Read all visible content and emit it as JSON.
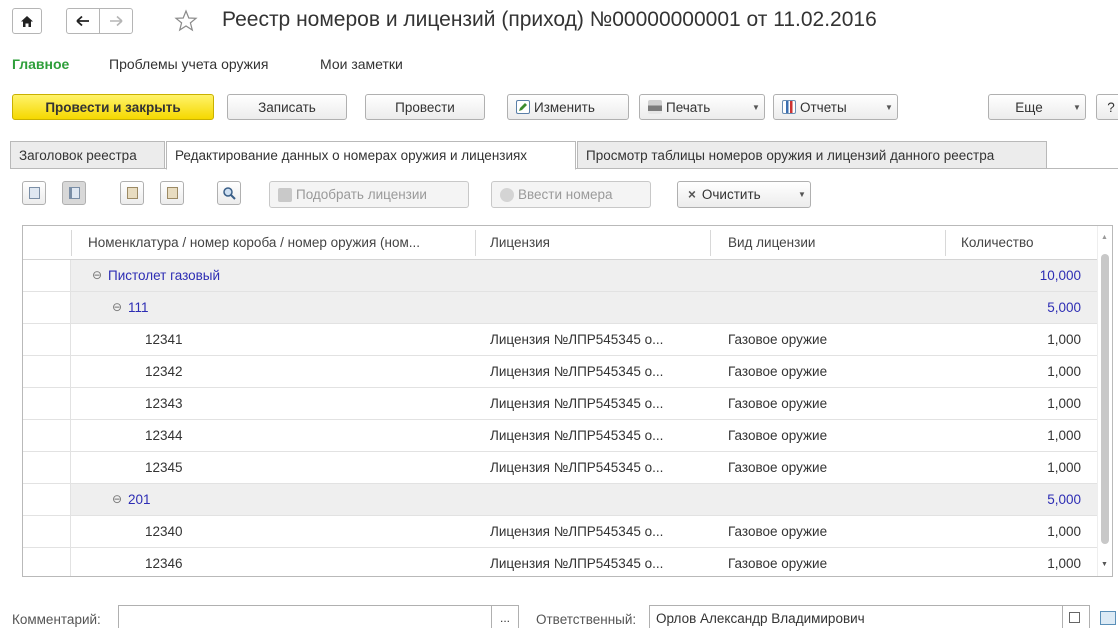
{
  "window": {
    "title": "Реестр номеров и лицензий (приход) №00000000001 от 11.02.2016",
    "icons": [
      "home-icon",
      "back-arrow-icon",
      "forward-arrow-icon",
      "star-icon"
    ]
  },
  "subnav": {
    "items": [
      "Главное",
      "Проблемы учета оружия",
      "Мои заметки"
    ]
  },
  "toolbar": {
    "post_close": "Провести и закрыть",
    "save": "Записать",
    "post": "Провести",
    "edit": "Изменить",
    "print": "Печать",
    "reports": "Отчеты",
    "more": "Еще",
    "help": "?"
  },
  "tabs": [
    {
      "label": "Заголовок реестра"
    },
    {
      "label": "Редактирование данных о номерах оружия и лицензиях"
    },
    {
      "label": "Просмотр таблицы номеров оружия и лицензий данного реестра"
    }
  ],
  "table_toolbar": {
    "pick_licenses": "Подобрать лицензии",
    "enter_numbers": "Ввести номера",
    "clear": "Очистить",
    "clear_icon": "×"
  },
  "grid": {
    "columns": [
      "Номенклатура / номер короба / номер оружия (ном...",
      "Лицензия",
      "Вид лицензии",
      "Количество"
    ],
    "rows": [
      {
        "type": "group",
        "level": 0,
        "name": "Пистолет газовый",
        "license": "",
        "kind": "",
        "qty": "10,000"
      },
      {
        "type": "group",
        "level": 1,
        "name": "111",
        "license": "",
        "kind": "",
        "qty": "5,000"
      },
      {
        "type": "item",
        "level": 2,
        "name": "12341",
        "license": "Лицензия №ЛПР545345 о...",
        "kind": "Газовое оружие",
        "qty": "1,000"
      },
      {
        "type": "item",
        "level": 2,
        "name": "12342",
        "license": "Лицензия №ЛПР545345 о...",
        "kind": "Газовое оружие",
        "qty": "1,000"
      },
      {
        "type": "item",
        "level": 2,
        "name": "12343",
        "license": "Лицензия №ЛПР545345 о...",
        "kind": "Газовое оружие",
        "qty": "1,000"
      },
      {
        "type": "item",
        "level": 2,
        "name": "12344",
        "license": "Лицензия №ЛПР545345 о...",
        "kind": "Газовое оружие",
        "qty": "1,000"
      },
      {
        "type": "item",
        "level": 2,
        "name": "12345",
        "license": "Лицензия №ЛПР545345 о...",
        "kind": "Газовое оружие",
        "qty": "1,000"
      },
      {
        "type": "group",
        "level": 1,
        "name": "201",
        "license": "",
        "kind": "",
        "qty": "5,000"
      },
      {
        "type": "item",
        "level": 2,
        "name": "12340",
        "license": "Лицензия №ЛПР545345 о...",
        "kind": "Газовое оружие",
        "qty": "1,000"
      },
      {
        "type": "item",
        "level": 2,
        "name": "12346",
        "license": "Лицензия №ЛПР545345 о...",
        "kind": "Газовое оружие",
        "qty": "1,000"
      }
    ]
  },
  "footer": {
    "comment_label": "Комментарий:",
    "comment_value": "",
    "ellipsis": "...",
    "responsible_label": "Ответственный:",
    "responsible_value": "Орлов Александр Владимирович"
  },
  "colors": {
    "primary_button": "#f5d800",
    "active_nav": "#2e9f3a",
    "group_text": "#2d2db4"
  }
}
